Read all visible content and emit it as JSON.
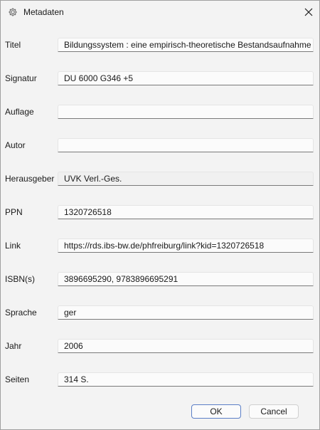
{
  "window": {
    "title": "Metadaten",
    "icon": "gear-icon"
  },
  "fields": [
    {
      "label": "Titel",
      "value": "Bildungssystem : eine empirisch-theoretische Bestandsaufnahme"
    },
    {
      "label": "Signatur",
      "value": "DU 6000 G346 +5"
    },
    {
      "label": "Auflage",
      "value": ""
    },
    {
      "label": "Autor",
      "value": ""
    },
    {
      "label": "Herausgeber",
      "value": "UVK Verl.-Ges."
    },
    {
      "label": "PPN",
      "value": "1320726518"
    },
    {
      "label": "Link",
      "value": "https://rds.ibs-bw.de/phfreiburg/link?kid=1320726518"
    },
    {
      "label": "ISBN(s)",
      "value": "3896695290, 9783896695291"
    },
    {
      "label": "Sprache",
      "value": "ger"
    },
    {
      "label": "Jahr",
      "value": "2006"
    },
    {
      "label": "Seiten",
      "value": "314 S."
    }
  ],
  "buttons": {
    "ok": "OK",
    "cancel": "Cancel"
  },
  "colors": {
    "window_bg": "#f3f3f3",
    "field_underline": "#7a7a7a",
    "accent": "#5b7fc7"
  }
}
